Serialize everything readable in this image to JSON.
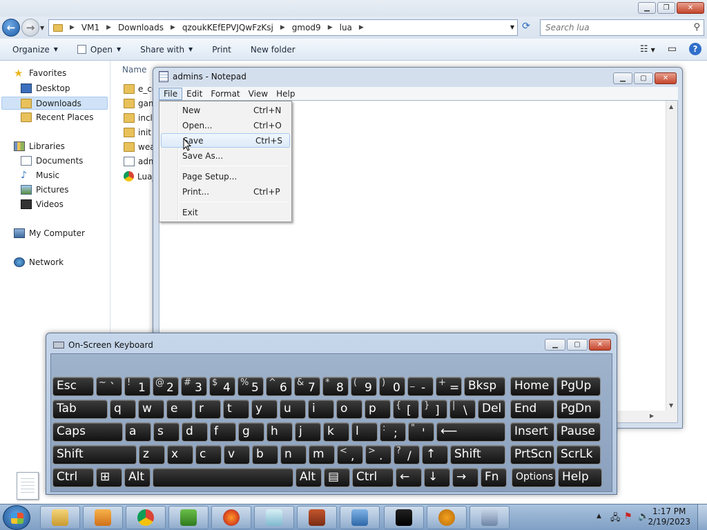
{
  "explorer": {
    "breadcrumb": [
      "VM1",
      "Downloads",
      "qzoukKEfEPVJQwFzKsj",
      "gmod9",
      "lua"
    ],
    "search_placeholder": "Search lua",
    "commands": [
      "Organize",
      "Open",
      "Share with",
      "Print",
      "New folder"
    ],
    "nav": {
      "favorites": "Favorites",
      "desktop": "Desktop",
      "downloads": "Downloads",
      "recent": "Recent Places",
      "libraries": "Libraries",
      "documents": "Documents",
      "music": "Music",
      "pictures": "Pictures",
      "videos": "Videos",
      "computer": "My Computer",
      "network": "Network"
    },
    "column_name": "Name",
    "files": [
      "e_co",
      "gam",
      "inclu",
      "init",
      "weap",
      "adm",
      "Lua_"
    ]
  },
  "notepad": {
    "title": "admins - Notepad",
    "menus": [
      "File",
      "Edit",
      "Format",
      "View",
      "Help"
    ],
    "file_menu": [
      {
        "label": "New",
        "shortcut": "Ctrl+N"
      },
      {
        "label": "Open...",
        "shortcut": "Ctrl+O"
      },
      {
        "label": "Save",
        "shortcut": "Ctrl+S"
      },
      {
        "label": "Save As...",
        "shortcut": ""
      },
      {
        "label": "Page Setup...",
        "shortcut": ""
      },
      {
        "label": "Print...",
        "shortcut": "Ctrl+P"
      },
      {
        "label": "Exit",
        "shortcut": ""
      }
    ],
    "highlighted_item": "Save"
  },
  "osk": {
    "title": "On-Screen Keyboard",
    "rows": [
      [
        {
          "t": "Esc"
        },
        {
          "s": "~",
          "m": "`"
        },
        {
          "s": "!",
          "m": "1"
        },
        {
          "s": "@",
          "m": "2"
        },
        {
          "s": "#",
          "m": "3"
        },
        {
          "s": "$",
          "m": "4"
        },
        {
          "s": "%",
          "m": "5"
        },
        {
          "s": "^",
          "m": "6"
        },
        {
          "s": "&",
          "m": "7"
        },
        {
          "s": "*",
          "m": "8"
        },
        {
          "s": "(",
          "m": "9"
        },
        {
          "s": ")",
          "m": "0"
        },
        {
          "s": "_",
          "m": "-"
        },
        {
          "s": "+",
          "m": "="
        },
        {
          "t": "Bksp"
        },
        {
          "t": "Home"
        },
        {
          "t": "PgUp"
        }
      ],
      [
        {
          "t": "Tab"
        },
        {
          "t": "q"
        },
        {
          "t": "w"
        },
        {
          "t": "e"
        },
        {
          "t": "r"
        },
        {
          "t": "t"
        },
        {
          "t": "y"
        },
        {
          "t": "u"
        },
        {
          "t": "i"
        },
        {
          "t": "o"
        },
        {
          "t": "p"
        },
        {
          "s": "{",
          "m": "["
        },
        {
          "s": "}",
          "m": "]"
        },
        {
          "s": "|",
          "m": "\\"
        },
        {
          "t": "Del"
        },
        {
          "t": "End"
        },
        {
          "t": "PgDn"
        }
      ],
      [
        {
          "t": "Caps"
        },
        {
          "t": "a"
        },
        {
          "t": "s"
        },
        {
          "t": "d"
        },
        {
          "t": "f"
        },
        {
          "t": "g"
        },
        {
          "t": "h"
        },
        {
          "t": "j"
        },
        {
          "t": "k"
        },
        {
          "t": "l"
        },
        {
          "s": ":",
          "m": ";"
        },
        {
          "s": "\"",
          "m": "'"
        },
        {
          "t": "⟵"
        },
        {
          "t": "Insert"
        },
        {
          "t": "Pause"
        }
      ],
      [
        {
          "t": "Shift"
        },
        {
          "t": "z"
        },
        {
          "t": "x"
        },
        {
          "t": "c"
        },
        {
          "t": "v"
        },
        {
          "t": "b"
        },
        {
          "t": "n"
        },
        {
          "t": "m"
        },
        {
          "s": "<",
          "m": ","
        },
        {
          "s": ">",
          "m": "."
        },
        {
          "s": "?",
          "m": "/"
        },
        {
          "t": "↑"
        },
        {
          "t": "Shift"
        },
        {
          "t": "PrtScn"
        },
        {
          "t": "ScrLk"
        }
      ],
      [
        {
          "t": "Ctrl"
        },
        {
          "t": "⊞"
        },
        {
          "t": "Alt"
        },
        {
          "t": ""
        },
        {
          "t": "Alt"
        },
        {
          "t": "▤"
        },
        {
          "t": "Ctrl"
        },
        {
          "t": "←"
        },
        {
          "t": "↓"
        },
        {
          "t": "→"
        },
        {
          "t": "Fn"
        },
        {
          "t": "Options"
        },
        {
          "t": "Help"
        }
      ]
    ]
  },
  "taskbar": {
    "time": "1:17 PM",
    "date": "2/19/2023",
    "apps": [
      "explorer-icon",
      "media-player-icon",
      "chrome-icon",
      "csharp-icon",
      "firefox-icon",
      "notepad-icon",
      "firewall-icon",
      "control-panel-icon",
      "cmd-icon",
      "half-life-icon",
      "osk-icon"
    ]
  }
}
